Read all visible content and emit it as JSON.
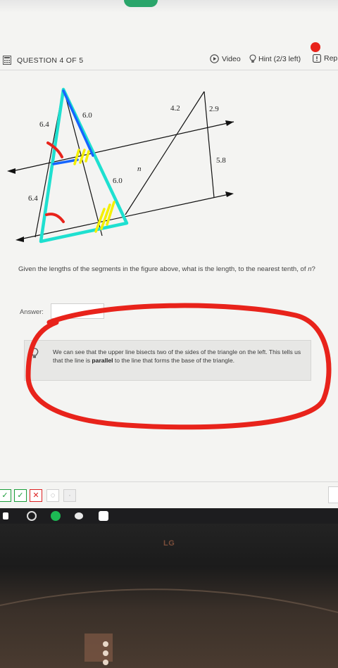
{
  "header": {
    "question_title": "QUESTION 4 OF 5",
    "video_label": "Video",
    "hint_label": "Hint (2/3 left)",
    "report_label": "Rep"
  },
  "figure": {
    "labels": {
      "left_top_side": "6.4",
      "left_bottom_side": "6.4",
      "top_side": "6.0",
      "middle_side": "6.0",
      "right_top_a": "4.2",
      "right_top_b": "2.9",
      "right_side": "5.8",
      "unknown": "n"
    }
  },
  "question": {
    "text_before": "Given the lengths of the segments in the figure above, what is the length, to the nearest tenth, of ",
    "variable": "n",
    "text_after": "?"
  },
  "answer": {
    "label": "Answer:",
    "value": ""
  },
  "hint": {
    "text_before": "We can see that the upper line bisects two of the sides of the triangle on the left. This tells us that the line is ",
    "bold": "parallel",
    "text_after": " to the line that forms the base of the triangle."
  },
  "monitor": {
    "brand": "LG"
  },
  "colors": {
    "annotation_red": "#e8231b",
    "annotation_cyan": "#1ee0d0",
    "annotation_yellow": "#f4f000",
    "annotation_blue": "#1565ff"
  }
}
